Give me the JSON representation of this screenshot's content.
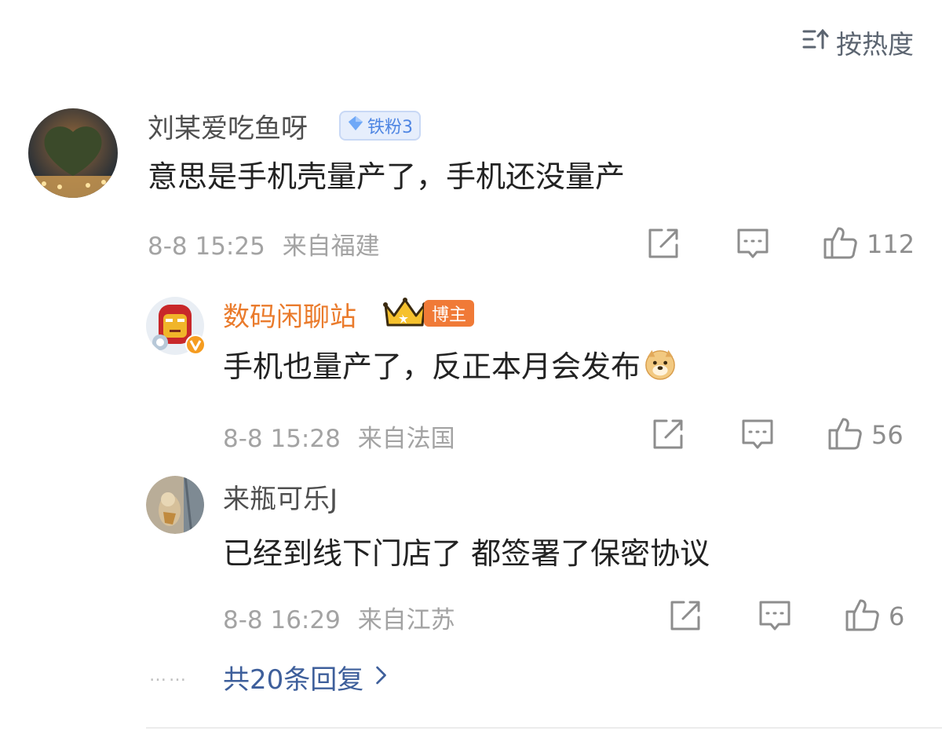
{
  "sort": {
    "label": "按热度"
  },
  "comment": {
    "author": "刘某爱吃鱼呀",
    "fan_badge": "铁粉3",
    "text": "意思是手机壳量产了，手机还没量产",
    "time": "8-8 15:25",
    "location": "来自福建",
    "likes": "112"
  },
  "replies": [
    {
      "author": "数码闲聊站",
      "host_badge": "博主",
      "text": "手机也量产了，反正本月会发布",
      "time": "8-8 15:28",
      "location": "来自法国",
      "likes": "56"
    },
    {
      "author": "来瓶可乐J",
      "text": "已经到线下门店了 都签署了保密协议",
      "time": "8-8 16:29",
      "location": "来自江苏",
      "likes": "6"
    }
  ],
  "more_replies": {
    "label": "共20条回复"
  },
  "colors": {
    "blogger_name": "#ea7b2c",
    "link": "#3e5f9b",
    "host_badge": "#f07a37",
    "fan_badge": "#4f86e3"
  },
  "icons": [
    "sort-icon",
    "repost-icon",
    "reply-icon",
    "like-icon",
    "chevron-right-icon",
    "diamond-icon",
    "crown-icon",
    "verified-icon",
    "doge-emoji"
  ]
}
